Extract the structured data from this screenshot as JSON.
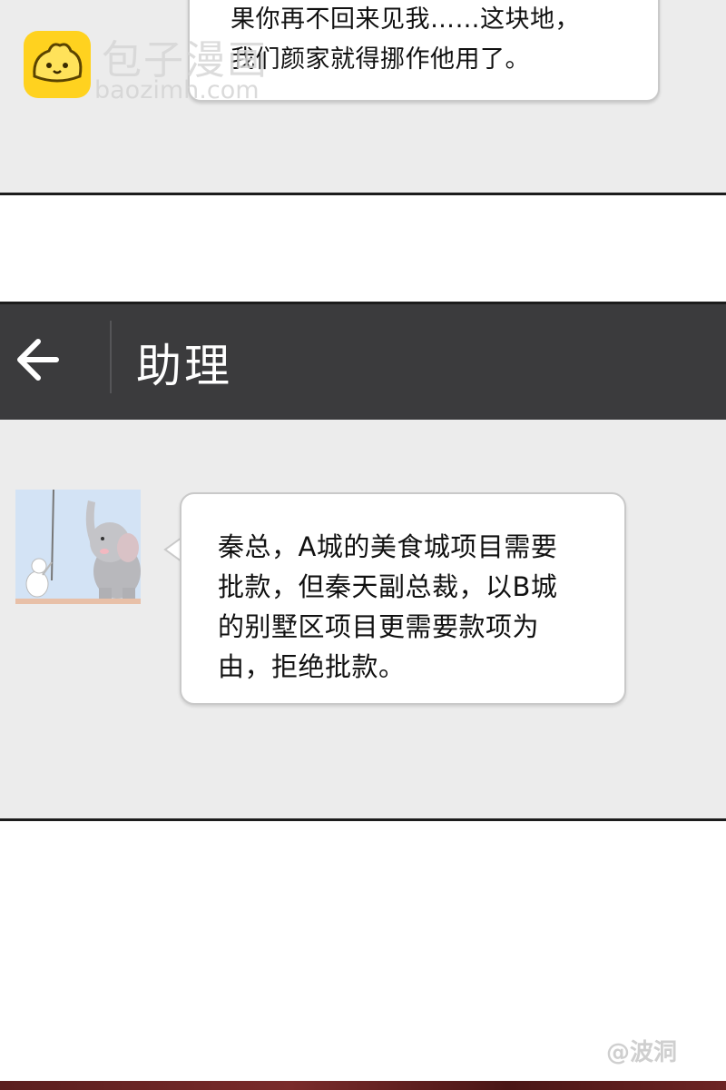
{
  "previous_message": {
    "line1": "果你再不回来见我……这块地，",
    "line2": "我们颜家就得挪作他用了。"
  },
  "watermark": {
    "site_name": "包子漫画",
    "url": "baozimh.com",
    "logo_icon": "bun-logo-icon",
    "bottom_mark": "@波洞"
  },
  "chat": {
    "title": "助理",
    "back_icon": "back-arrow-icon",
    "avatar_icon": "elephant-avatar-icon",
    "message": {
      "line1": "秦总，A城的美食城项目需要",
      "line2": "批款，但秦天副总裁，以B城",
      "line3": "的别墅区项目更需要款项为",
      "line4": "由，拒绝批款。"
    }
  },
  "colors": {
    "header_bg": "#3b3b3d",
    "chat_bg": "#ececec",
    "bubble_bg": "#ffffff",
    "logo_yellow": "#ffd21f"
  }
}
